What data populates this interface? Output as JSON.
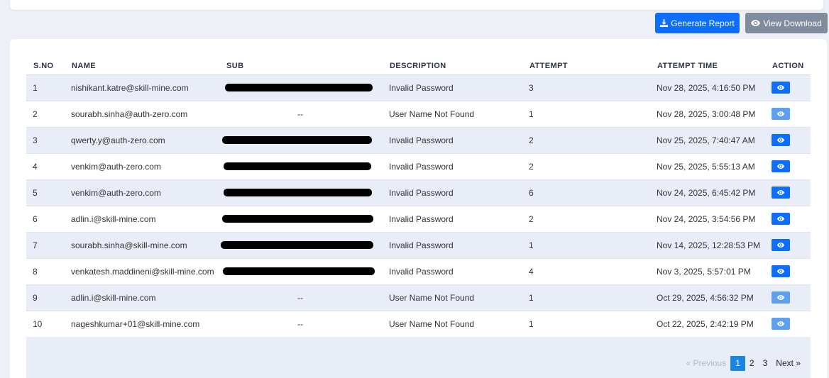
{
  "toolbar": {
    "generate_label": "Generate Report",
    "view_download_label": "View Download"
  },
  "table": {
    "columns": [
      "S.NO",
      "NAME",
      "SUB",
      "DESCRIPTION",
      "ATTEMPT",
      "ATTEMPT TIME",
      "ACTION"
    ],
    "rows": [
      {
        "sno": "1",
        "name": "nishikant.katre@skill-mine.com",
        "sub": "",
        "desc": "Invalid Password",
        "attempt": "3",
        "time": "Nov 28, 2025, 4:16:50 PM"
      },
      {
        "sno": "2",
        "name": "sourabh.sinha@auth-zero.com",
        "sub": "--",
        "desc": "User Name Not Found",
        "attempt": "1",
        "time": "Nov 28, 2025, 3:00:48 PM"
      },
      {
        "sno": "3",
        "name": "qwerty.y@auth-zero.com",
        "sub": "",
        "desc": "Invalid Password",
        "attempt": "2",
        "time": "Nov 25, 2025, 7:40:47 AM"
      },
      {
        "sno": "4",
        "name": "venkim@auth-zero.com",
        "sub": "",
        "desc": "Invalid Password",
        "attempt": "2",
        "time": "Nov 25, 2025, 5:55:13 AM"
      },
      {
        "sno": "5",
        "name": "venkim@auth-zero.com",
        "sub": "",
        "desc": "Invalid Password",
        "attempt": "6",
        "time": "Nov 24, 2025, 6:45:42 PM"
      },
      {
        "sno": "6",
        "name": "adlin.i@skill-mine.com",
        "sub": "",
        "desc": "Invalid Password",
        "attempt": "2",
        "time": "Nov 24, 2025, 3:54:56 PM"
      },
      {
        "sno": "7",
        "name": "sourabh.sinha@skill-mine.com",
        "sub": "",
        "desc": "Invalid Password",
        "attempt": "1",
        "time": "Nov 14, 2025, 12:28:53 PM"
      },
      {
        "sno": "8",
        "name": "venkatesh.maddineni@skill-mine.com",
        "sub": "",
        "desc": "Invalid Password",
        "attempt": "4",
        "time": "Nov 3, 2025, 5:57:01 PM"
      },
      {
        "sno": "9",
        "name": "adlin.i@skill-mine.com",
        "sub": "--",
        "desc": "User Name Not Found",
        "attempt": "1",
        "time": "Oct 29, 2025, 4:56:32 PM"
      },
      {
        "sno": "10",
        "name": "nageshkumar+01@skill-mine.com",
        "sub": "--",
        "desc": "User Name Not Found",
        "attempt": "1",
        "time": "Oct 22, 2025, 2:42:19 PM"
      }
    ]
  },
  "pagination": {
    "previous_label": "Previous",
    "next_label": "Next",
    "pages": [
      "1",
      "2",
      "3"
    ],
    "current": "1"
  },
  "icons": {
    "generate": "download-icon",
    "view": "eye-icon",
    "action": "eye-icon"
  },
  "colors": {
    "primary": "#0d6efd",
    "secondary": "#7f8c9d",
    "row_stripe": "#e9edf8",
    "active_page": "#1a86e0"
  }
}
